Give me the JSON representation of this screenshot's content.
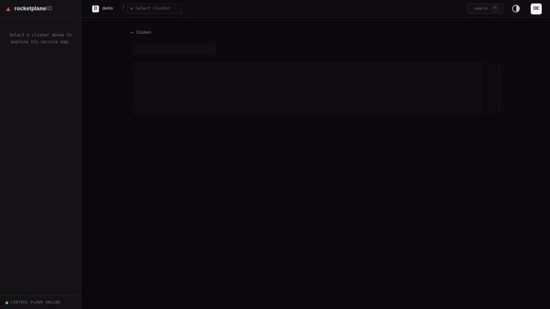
{
  "brand": {
    "name": "rocketplane",
    "suffix": "IO",
    "icon": "triangle-logo-icon",
    "accent": "#e0523a"
  },
  "sidebar": {
    "hint": "Select a cluster above to explore its service map.",
    "status": {
      "text": "CONTROL-PLANE ONLINE",
      "color": "#3ecf7a"
    }
  },
  "topbar": {
    "org": {
      "initial": "D",
      "name": "demo"
    },
    "separator": "/",
    "cluster_select": {
      "placeholder": "Select cluster"
    },
    "search": {
      "label": "search",
      "shortcut": "⌘K"
    },
    "theme_toggle": "contrast-icon",
    "user": {
      "initials": "DE"
    }
  },
  "main": {
    "back_link": {
      "arrow": "←",
      "label": "Clusters"
    }
  }
}
